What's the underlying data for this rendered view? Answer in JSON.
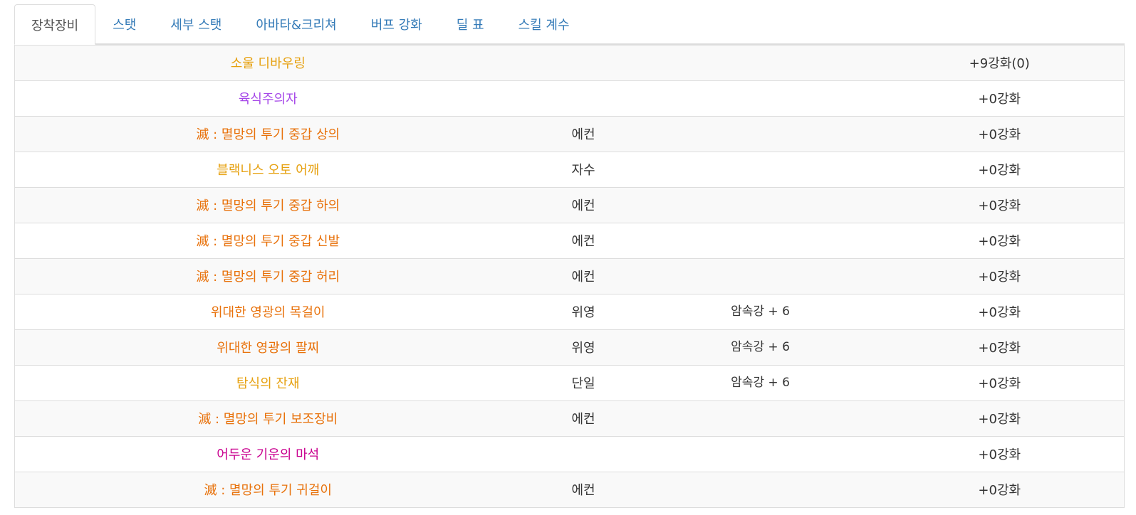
{
  "tabs": [
    {
      "label": "장착장비",
      "active": true
    },
    {
      "label": "스탯",
      "active": false
    },
    {
      "label": "세부 스탯",
      "active": false
    },
    {
      "label": "아바타&크리쳐",
      "active": false
    },
    {
      "label": "버프 강화",
      "active": false
    },
    {
      "label": "딜 표",
      "active": false
    },
    {
      "label": "스킬 계수",
      "active": false
    }
  ],
  "rarity_colors": {
    "epic": "#e6a00e",
    "unique": "#a546e8",
    "legendary": "#e8710a",
    "rare": "#c9008f"
  },
  "equipment": [
    {
      "name": "소울 디바우링",
      "rarity": "epic",
      "set": "",
      "option": "",
      "reinforce": "+9강화(0)"
    },
    {
      "name": "육식주의자",
      "rarity": "unique",
      "set": "",
      "option": "",
      "reinforce": "+0강화"
    },
    {
      "name": "滅 : 멸망의 투기 중갑 상의",
      "rarity": "legendary",
      "set": "에컨",
      "option": "",
      "reinforce": "+0강화"
    },
    {
      "name": "블랙니스 오토 어깨",
      "rarity": "epic",
      "set": "자수",
      "option": "",
      "reinforce": "+0강화"
    },
    {
      "name": "滅 : 멸망의 투기 중갑 하의",
      "rarity": "legendary",
      "set": "에컨",
      "option": "",
      "reinforce": "+0강화"
    },
    {
      "name": "滅 : 멸망의 투기 중갑 신발",
      "rarity": "legendary",
      "set": "에컨",
      "option": "",
      "reinforce": "+0강화"
    },
    {
      "name": "滅 : 멸망의 투기 중갑 허리",
      "rarity": "legendary",
      "set": "에컨",
      "option": "",
      "reinforce": "+0강화"
    },
    {
      "name": "위대한 영광의 목걸이",
      "rarity": "legendary",
      "set": "위영",
      "option": "암속강 + 6",
      "reinforce": "+0강화"
    },
    {
      "name": "위대한 영광의 팔찌",
      "rarity": "legendary",
      "set": "위영",
      "option": "암속강 + 6",
      "reinforce": "+0강화"
    },
    {
      "name": "탐식의 잔재",
      "rarity": "epic",
      "set": "단일",
      "option": "암속강 + 6",
      "reinforce": "+0강화"
    },
    {
      "name": "滅 : 멸망의 투기 보조장비",
      "rarity": "legendary",
      "set": "에컨",
      "option": "",
      "reinforce": "+0강화"
    },
    {
      "name": "어두운 기운의 마석",
      "rarity": "rare",
      "set": "",
      "option": "",
      "reinforce": "+0강화"
    },
    {
      "name": "滅 : 멸망의 투기 귀걸이",
      "rarity": "legendary",
      "set": "에컨",
      "option": "",
      "reinforce": "+0강화"
    }
  ]
}
